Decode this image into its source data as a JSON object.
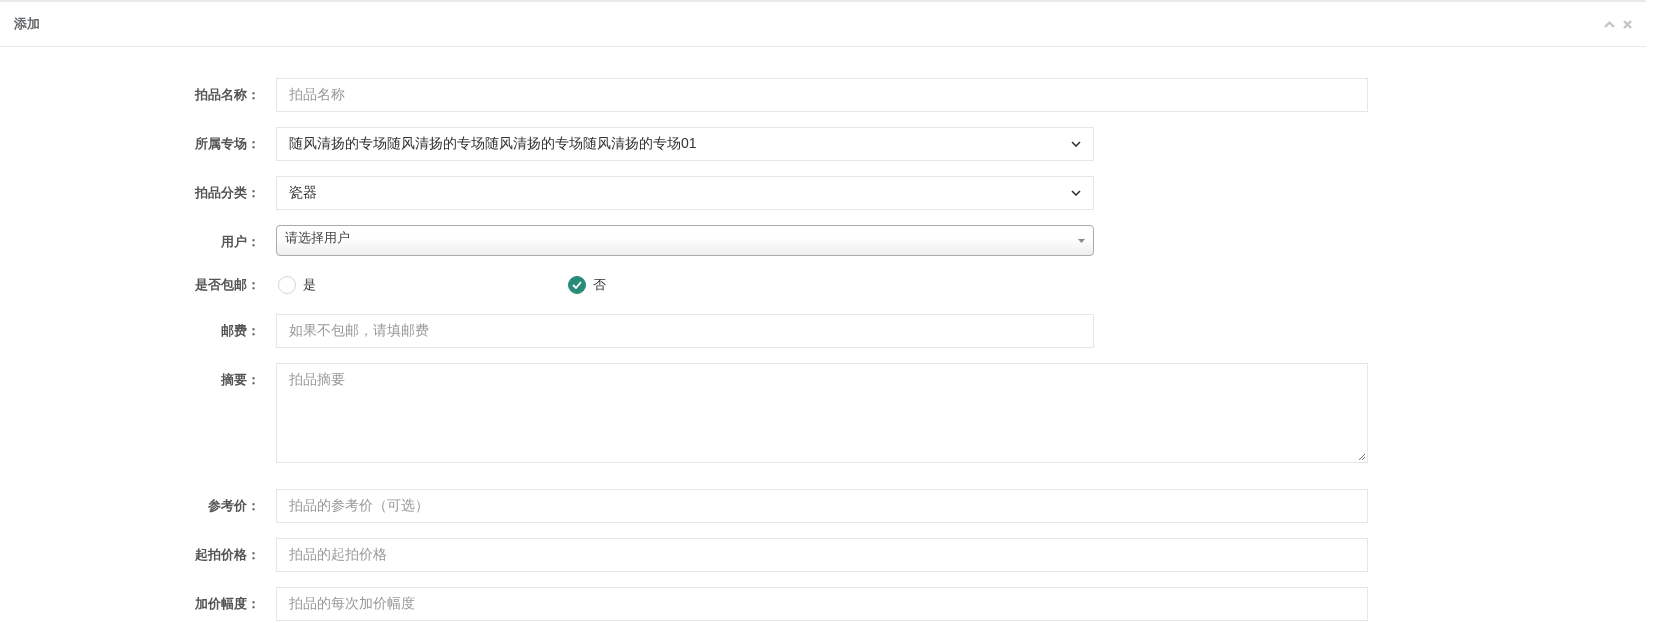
{
  "panel": {
    "title": "添加"
  },
  "fields": [
    {
      "kind": "input",
      "label": "拍品名称：",
      "placeholder": "拍品名称"
    },
    {
      "kind": "select",
      "label": "所属专场：",
      "value": "随风清扬的专场随风清扬的专场随风清扬的专场随风清扬的专场01"
    },
    {
      "kind": "select",
      "label": "拍品分类：",
      "value": "瓷器"
    },
    {
      "kind": "combo",
      "label": "用户：",
      "value": "请选择用户"
    },
    {
      "kind": "radio",
      "label": "是否包邮：",
      "options": [
        {
          "label": "是",
          "selected": false
        },
        {
          "label": "否",
          "selected": true
        }
      ]
    },
    {
      "kind": "input",
      "label": "邮费：",
      "placeholder": "如果不包邮，请填邮费"
    },
    {
      "kind": "textarea",
      "label": "摘要：",
      "placeholder": "拍品摘要"
    },
    {
      "kind": "input",
      "label": "参考价：",
      "placeholder": "拍品的参考价（可选）"
    },
    {
      "kind": "input",
      "label": "起拍价格：",
      "placeholder": "拍品的起拍价格"
    },
    {
      "kind": "input",
      "label": "加价幅度：",
      "placeholder": "拍品的每次加价幅度"
    }
  ]
}
